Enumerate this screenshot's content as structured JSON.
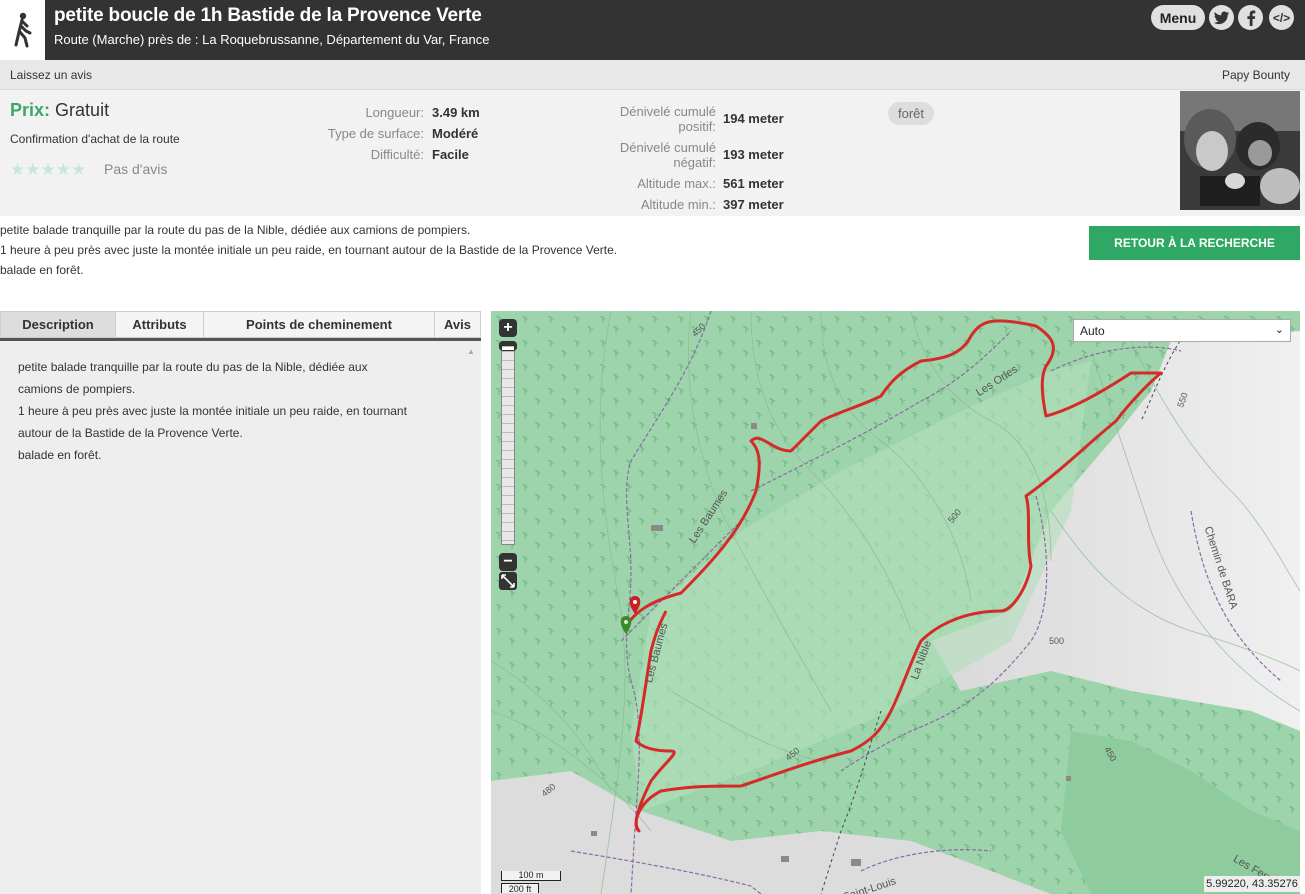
{
  "header": {
    "title": "petite boucle de 1h Bastide de la Provence Verte",
    "subtitle": "Route (Marche) près de : La Roquebrussanne, Département du Var, France",
    "menu_label": "Menu",
    "embed_label": "</>"
  },
  "subheader": {
    "review_link": "Laissez un avis",
    "author": "Papy Bounty"
  },
  "info": {
    "price_label": "Prix:",
    "price_value": "Gratuit",
    "confirm": "Confirmation d'achat de la route",
    "stars": "★★★★★",
    "rating": 0,
    "no_reviews": "Pas d'avis",
    "stats_left": [
      {
        "label": "Longueur:",
        "value": "3.49 km"
      },
      {
        "label": "Type de surface:",
        "value": "Modéré"
      },
      {
        "label": "Difficulté:",
        "value": "Facile"
      }
    ],
    "stats_right": [
      {
        "label1": "Dénivelé cumulé",
        "label2": "positif:",
        "value": "194 meter"
      },
      {
        "label1": "Dénivelé cumulé",
        "label2": "négatif:",
        "value": "193 meter"
      },
      {
        "label1": "Altitude max.:",
        "value": "561 meter"
      },
      {
        "label1": "Altitude min.:",
        "value": "397 meter"
      }
    ],
    "tag": "forêt"
  },
  "description": {
    "lines": [
      "petite balade tranquille par la route du pas de la Nible, dédiée aux camions de pompiers.",
      "1 heure à peu près avec juste la montée initiale un peu raide, en tournant autour de la Bastide de la Provence Verte.",
      "balade en forêt."
    ],
    "back_button": "RETOUR À LA RECHERCHE"
  },
  "tabs": {
    "items": [
      {
        "label": "Description"
      },
      {
        "label": "Attributs"
      },
      {
        "label": "Points de cheminement"
      },
      {
        "label": "Avis"
      }
    ],
    "active": 0,
    "body_lines": [
      "petite balade tranquille par la route du pas de la Nible, dédiée aux",
      "camions de pompiers.",
      "1 heure à peu près avec juste la montée initiale un peu raide, en tournant",
      "autour de la Bastide de la Provence Verte.",
      "balade en forêt."
    ]
  },
  "map": {
    "layer_select": "Auto",
    "zoom_in": "+",
    "zoom_out": "−",
    "scale_metric": "100 m",
    "scale_imperial": "200 ft",
    "coords": "5.99220, 43.35276",
    "labels": {
      "les_baumes_1": "Les Baumes",
      "les_baumes_2": "Les Baumes",
      "les_orles": "Les Orles",
      "la_nible": "La Nible",
      "chemin_bara": "Chemin de BARA",
      "saint_louis": "de Saint-Louis",
      "les_ferre": "Les Ferré",
      "c450a": "450",
      "c450b": "450",
      "c500a": "500",
      "c500b": "500",
      "c550": "550",
      "c480": "480",
      "c450c": "450"
    },
    "colors": {
      "track": "#d52a2a",
      "forest": "#9ed4ab",
      "start_marker": "#3a8a2a",
      "end_marker": "#cc1f1f"
    }
  }
}
